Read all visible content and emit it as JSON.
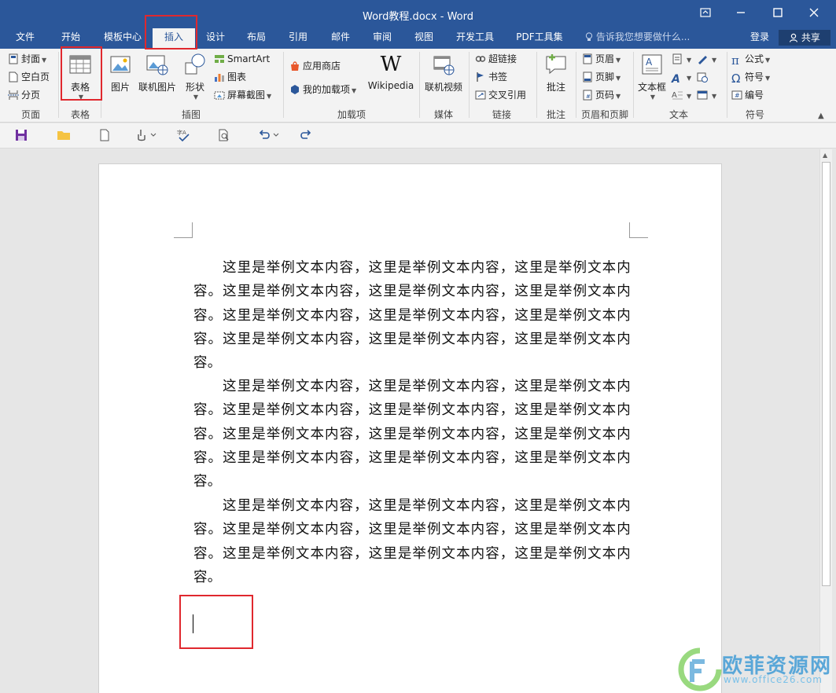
{
  "window": {
    "title": "Word教程.docx - Word",
    "controls": [
      "restore-icon",
      "minimize-icon",
      "maximize-icon",
      "close-icon"
    ]
  },
  "tabs": [
    {
      "label": "文件"
    },
    {
      "label": "开始"
    },
    {
      "label": "模板中心"
    },
    {
      "label": "插入"
    },
    {
      "label": "设计"
    },
    {
      "label": "布局"
    },
    {
      "label": "引用"
    },
    {
      "label": "邮件"
    },
    {
      "label": "审阅"
    },
    {
      "label": "视图"
    },
    {
      "label": "开发工具"
    },
    {
      "label": "PDF工具集"
    }
  ],
  "tell_me": "告诉我您想要做什么...",
  "account": {
    "login": "登录",
    "share": "共享"
  },
  "ribbon": {
    "pages": {
      "label": "页面",
      "cover": "封面",
      "blank": "空白页",
      "break": "分页"
    },
    "table": {
      "label": "表格",
      "button": "表格"
    },
    "illustrations": {
      "label": "插图",
      "picture": "图片",
      "online_picture": "联机图片",
      "shapes": "形状",
      "smartart": "SmartArt",
      "chart": "图表",
      "screenshot": "屏幕截图"
    },
    "addins": {
      "label": "加载项",
      "store": "应用商店",
      "my_addins": "我的加载项",
      "wikipedia": "Wikipedia"
    },
    "media": {
      "label": "媒体",
      "online_video": "联机视频"
    },
    "links": {
      "label": "链接",
      "hyperlink": "超链接",
      "bookmark": "书签",
      "cross_ref": "交叉引用"
    },
    "comments": {
      "label": "批注",
      "comment": "批注"
    },
    "header_footer": {
      "label": "页眉和页脚",
      "header": "页眉",
      "footer": "页脚",
      "page_number": "页码"
    },
    "text": {
      "label": "文本",
      "textbox": "文本框"
    },
    "symbols": {
      "label": "符号",
      "equation": "公式",
      "symbol": "符号",
      "number": "编号"
    }
  },
  "document": {
    "paragraphs": [
      "这里是举例文本内容，这里是举例文本内容，这里是举例文本内容。这里是举例文本内容，这里是举例文本内容，这里是举例文本内容。这里是举例文本内容，这里是举例文本内容，这里是举例文本内容。这里是举例文本内容，这里是举例文本内容，这里是举例文本内容。",
      "这里是举例文本内容，这里是举例文本内容，这里是举例文本内容。这里是举例文本内容，这里是举例文本内容，这里是举例文本内容。这里是举例文本内容，这里是举例文本内容，这里是举例文本内容。这里是举例文本内容，这里是举例文本内容，这里是举例文本内容。",
      "这里是举例文本内容，这里是举例文本内容，这里是举例文本内容。这里是举例文本内容，这里是举例文本内容，这里是举例文本内容。这里是举例文本内容，这里是举例文本内容，这里是举例文本内容。"
    ]
  },
  "watermark": {
    "text": "欧菲资源网",
    "url": "www.office26.com"
  },
  "colors": {
    "accent": "#2b579a",
    "highlight": "#e0282e"
  }
}
